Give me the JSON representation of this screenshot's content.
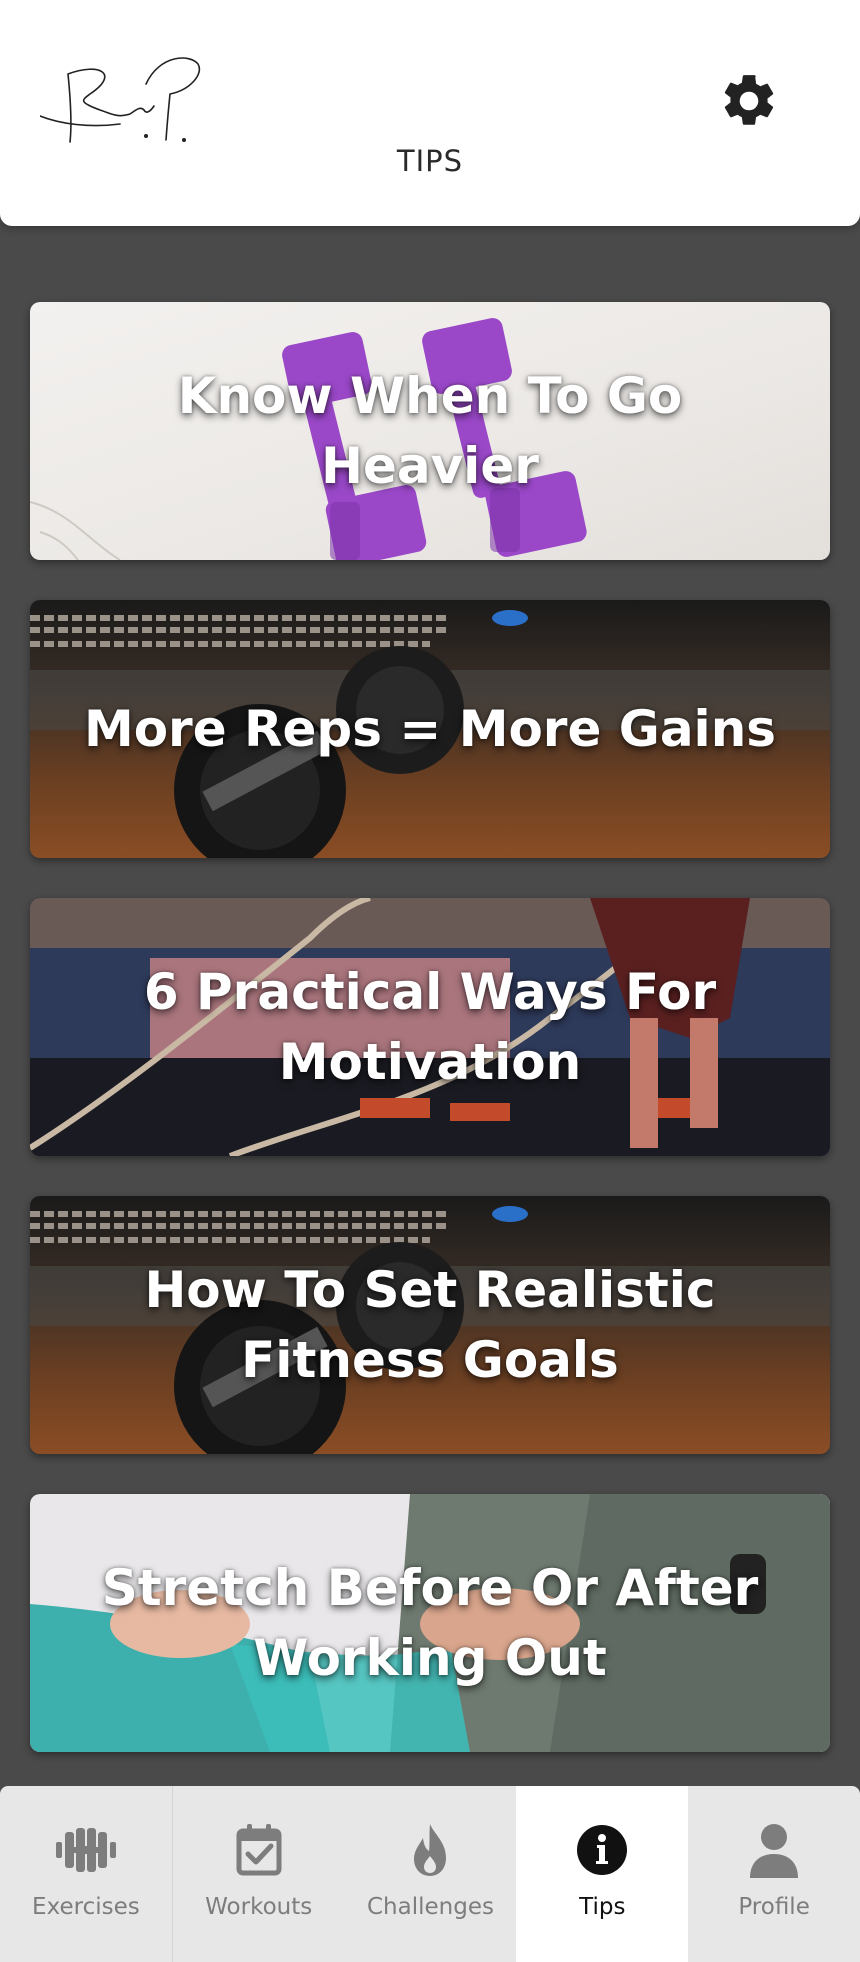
{
  "header": {
    "title": "TIPS",
    "logo_icon": "signature-logo",
    "settings_icon": "gear-icon"
  },
  "tips": [
    {
      "title": "Know When To Go Heavier",
      "image": "purple-dumbbells"
    },
    {
      "title": "More Reps = More Gains",
      "image": "barbell-weight-plate"
    },
    {
      "title": "6 Practical Ways For Motivation",
      "image": "battle-ropes"
    },
    {
      "title": "How To Set Realistic Fitness Goals",
      "image": "barbell-weight-plate"
    },
    {
      "title": "Stretch Before Or After Working Out",
      "image": "resistance-band"
    }
  ],
  "nav": {
    "items": [
      {
        "label": "Exercises",
        "icon": "dumbbell-icon",
        "active": false
      },
      {
        "label": "Workouts",
        "icon": "calendar-check-icon",
        "active": false
      },
      {
        "label": "Challenges",
        "icon": "flame-icon",
        "active": false
      },
      {
        "label": "Tips",
        "icon": "info-icon",
        "active": true
      },
      {
        "label": "Profile",
        "icon": "person-icon",
        "active": false
      }
    ]
  },
  "colors": {
    "background": "#4a4a4a",
    "header": "#ffffff",
    "nav_bg": "#e7e7e7",
    "nav_active_bg": "#ffffff",
    "nav_inactive_text": "#7d7d7d",
    "nav_active_text": "#111111",
    "dumbbell_purple": "#9a48c8"
  }
}
